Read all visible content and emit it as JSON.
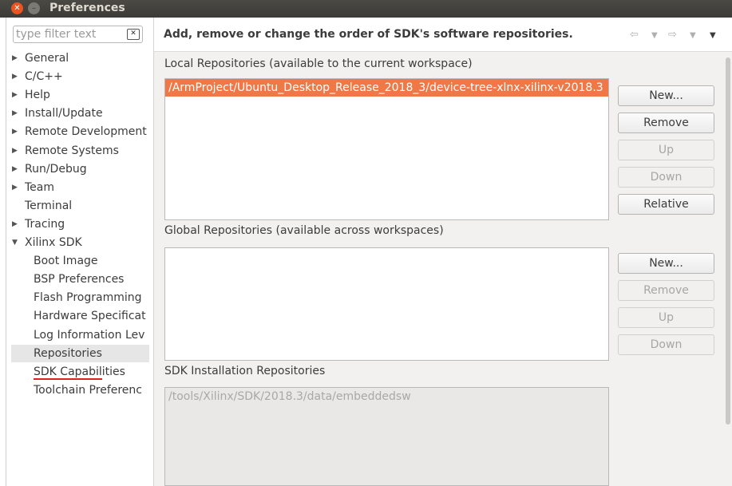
{
  "window": {
    "title": "Preferences"
  },
  "filter": {
    "placeholder": "type filter text"
  },
  "tree": [
    {
      "label": "General",
      "expander": "collapsed"
    },
    {
      "label": "C/C++",
      "expander": "collapsed"
    },
    {
      "label": "Help",
      "expander": "collapsed"
    },
    {
      "label": "Install/Update",
      "expander": "collapsed"
    },
    {
      "label": "Remote Development",
      "expander": "collapsed"
    },
    {
      "label": "Remote Systems",
      "expander": "collapsed"
    },
    {
      "label": "Run/Debug",
      "expander": "collapsed"
    },
    {
      "label": "Team",
      "expander": "collapsed"
    },
    {
      "label": "Terminal",
      "expander": "none"
    },
    {
      "label": "Tracing",
      "expander": "collapsed"
    },
    {
      "label": "Xilinx SDK",
      "expander": "expanded"
    },
    {
      "label": "Boot Image",
      "expander": "child"
    },
    {
      "label": "BSP Preferences",
      "expander": "child"
    },
    {
      "label": "Flash Programming",
      "expander": "child"
    },
    {
      "label": "Hardware Specificat",
      "expander": "child"
    },
    {
      "label": "Log Information Lev",
      "expander": "child"
    },
    {
      "label": "Repositories",
      "expander": "child",
      "selected": true
    },
    {
      "label": "SDK Capabilities",
      "expander": "child"
    },
    {
      "label": "Toolchain Preferenc",
      "expander": "child"
    }
  ],
  "page": {
    "description": "Add, remove or change the order of SDK's software repositories.",
    "local": {
      "label": "Local Repositories (available to the current workspace)",
      "items": [
        "/ArmProject/Ubuntu_Desktop_Release_2018_3/device-tree-xlnx-xilinx-v2018.3"
      ]
    },
    "global": {
      "label": "Global Repositories (available across workspaces)",
      "items": []
    },
    "install": {
      "label": "SDK Installation Repositories",
      "items": [
        "/tools/Xilinx/SDK/2018.3/data/embeddedsw"
      ]
    },
    "local_buttons": {
      "new": "New...",
      "remove": "Remove",
      "up": "Up",
      "down": "Down",
      "relative": "Relative"
    },
    "global_buttons": {
      "new": "New...",
      "remove": "Remove",
      "up": "Up",
      "down": "Down"
    }
  },
  "colors": {
    "selection": "#f07746",
    "title_close": "#e95420",
    "underline": "#e02020"
  }
}
